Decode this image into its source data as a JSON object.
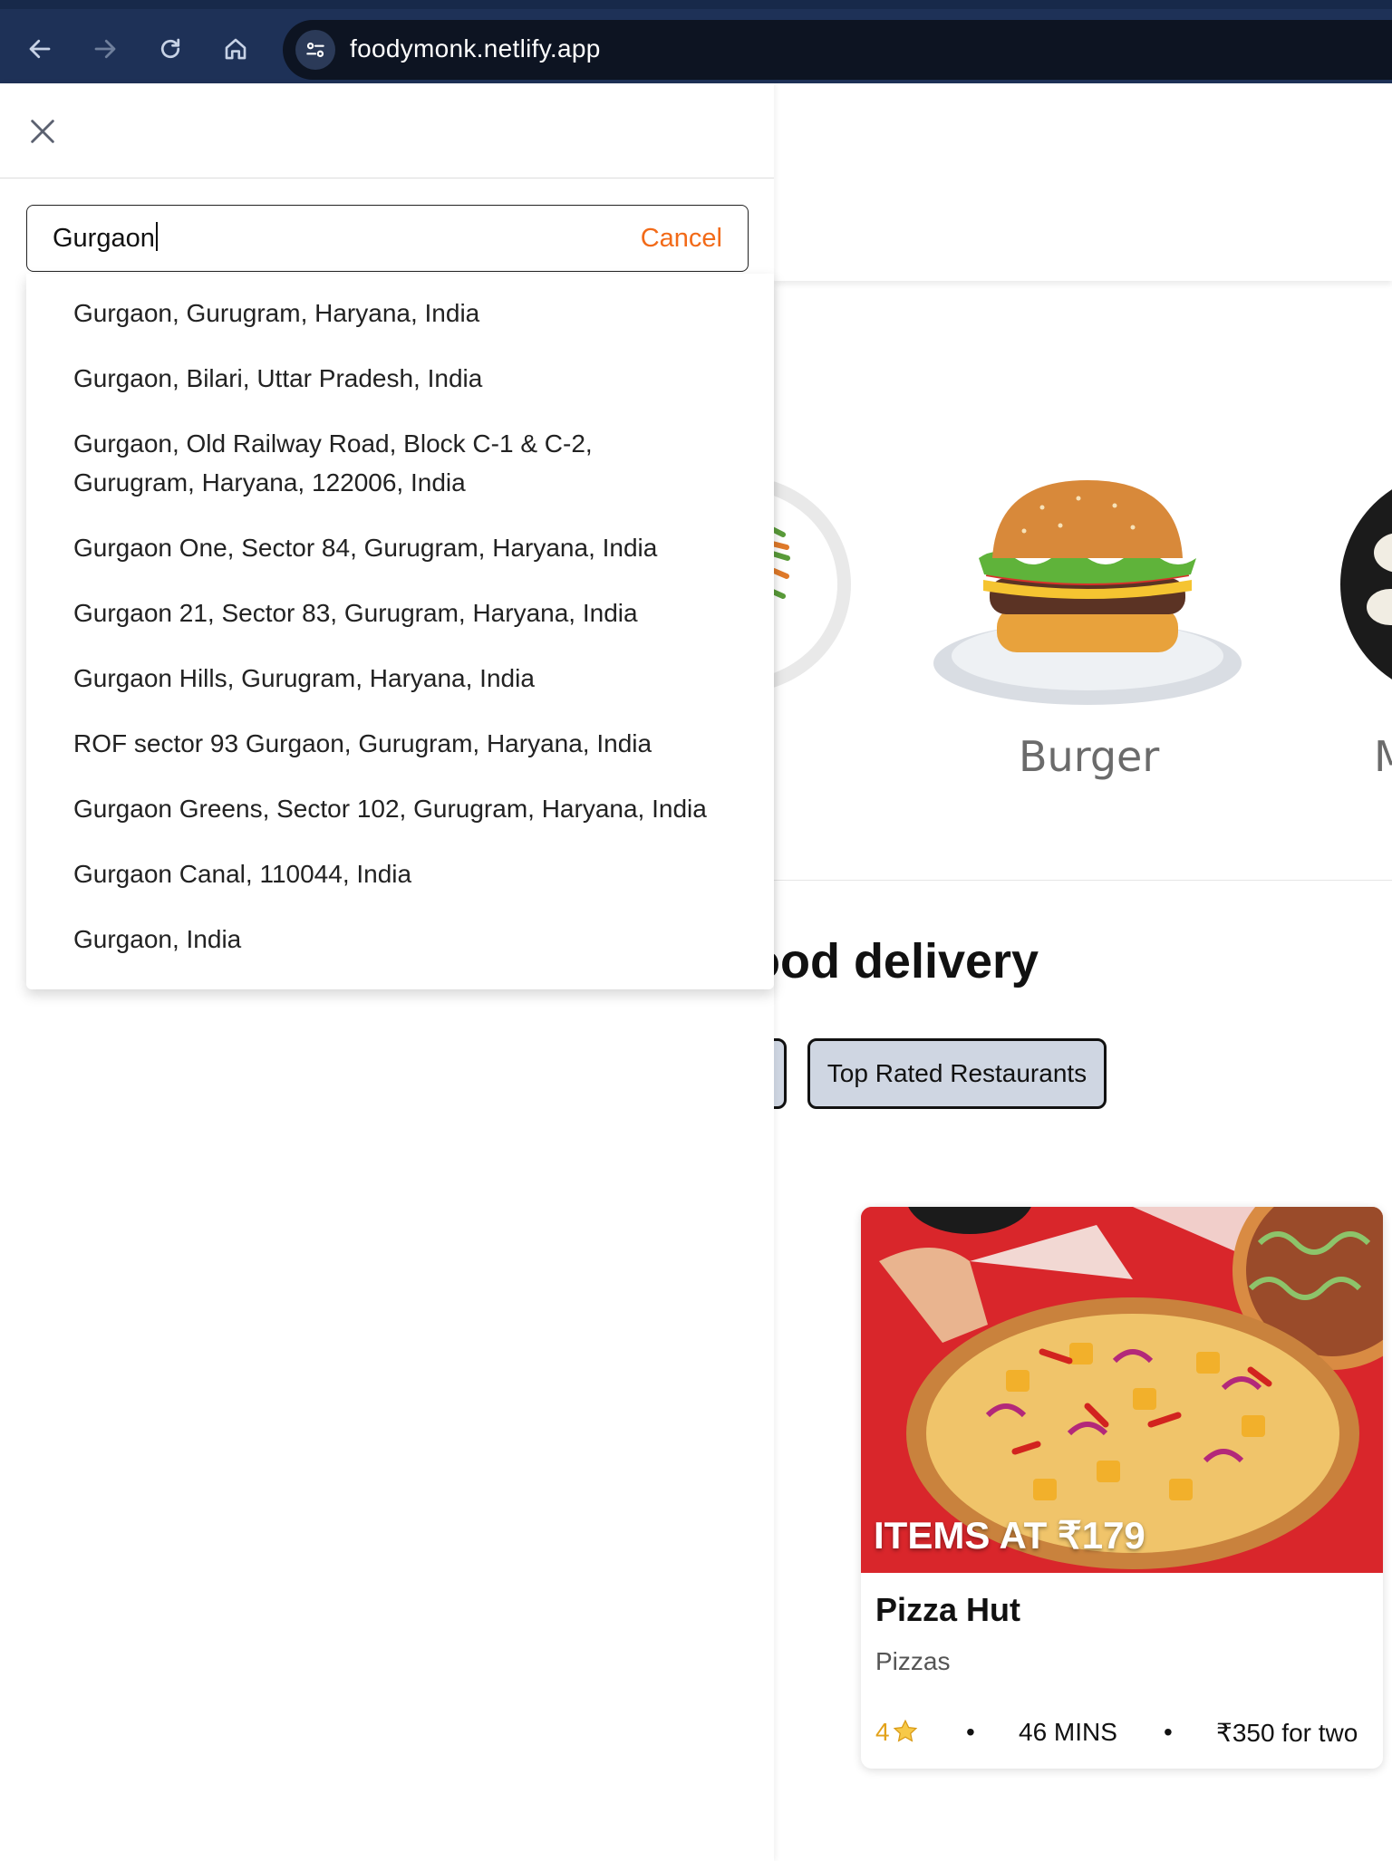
{
  "browser": {
    "url": "foodymonk.netlify.app",
    "icons": [
      "back-arrow-icon",
      "forward-arrow-icon",
      "reload-icon",
      "home-icon",
      "site-settings-icon"
    ]
  },
  "location_panel": {
    "search": {
      "value": "Gurgaon",
      "cancel_label": "Cancel"
    },
    "suggestions": [
      "Gurgaon, Gurugram, Haryana, India",
      "Gurgaon, Bilari, Uttar Pradesh, India",
      "Gurgaon, Old Railway Road, Block C-1 & C-2, Gurugram, Haryana, 122006, India",
      "Gurgaon One, Sector 84, Gurugram, Haryana, India",
      "Gurgaon 21, Sector 83, Gurugram, Haryana, India",
      "Gurgaon Hills, Gurugram, Haryana, India",
      "ROF sector 93 Gurgaon, Gurugram, Haryana, India",
      "Gurgaon Greens, Sector 102, Gurugram, Haryana, India",
      "Gurgaon Canal, 110044, India",
      "Gurgaon, India"
    ]
  },
  "categories": {
    "visible": [
      "Burger",
      "M"
    ]
  },
  "section": {
    "title": "food delivery",
    "filters": [
      "",
      "Top Rated Restaurants"
    ]
  },
  "restaurant_card": {
    "offer": "ITEMS AT ₹179",
    "name": "Pizza Hut",
    "cuisine": "Pizzas",
    "rating": "4",
    "rating_icon": "star-icon",
    "dot": "•",
    "delivery_time": "46 MINS",
    "cost": "₹350 for two"
  },
  "colors": {
    "accent": "#f26a18",
    "chrome": "#1e3157",
    "filter_bg": "#cfd6e2",
    "rating": "#e3a21a"
  }
}
